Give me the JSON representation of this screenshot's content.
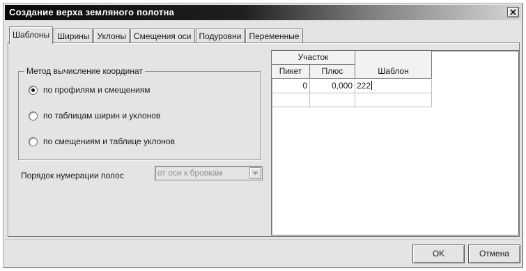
{
  "window": {
    "title": "Создание верха земляного полотна"
  },
  "tabs": [
    {
      "label": "Шаблоны",
      "active": true
    },
    {
      "label": "Ширины",
      "active": false
    },
    {
      "label": "Уклоны",
      "active": false
    },
    {
      "label": "Смещения оси",
      "active": false
    },
    {
      "label": "Подуровни",
      "active": false
    },
    {
      "label": "Переменные",
      "active": false
    }
  ],
  "coord_method": {
    "legend": "Метод вычисление координат",
    "options": [
      {
        "label": "по профилям и смещениям",
        "selected": true
      },
      {
        "label": "по таблицам ширин и уклонов",
        "selected": false
      },
      {
        "label": "по смещениям и таблице уклонов",
        "selected": false
      }
    ]
  },
  "numbering": {
    "label": "Порядок нумерации полос",
    "value": "от оси к бровкам",
    "disabled": true
  },
  "grid": {
    "group_header": "Участок",
    "columns": [
      "Пикет",
      "Плюс",
      "Шаблон"
    ],
    "rows": [
      {
        "piket": "0",
        "plus": "0,000",
        "shablon": "222"
      },
      {
        "piket": "",
        "plus": "",
        "shablon": ""
      }
    ]
  },
  "buttons": {
    "ok": "OK",
    "cancel": "Отмена"
  }
}
